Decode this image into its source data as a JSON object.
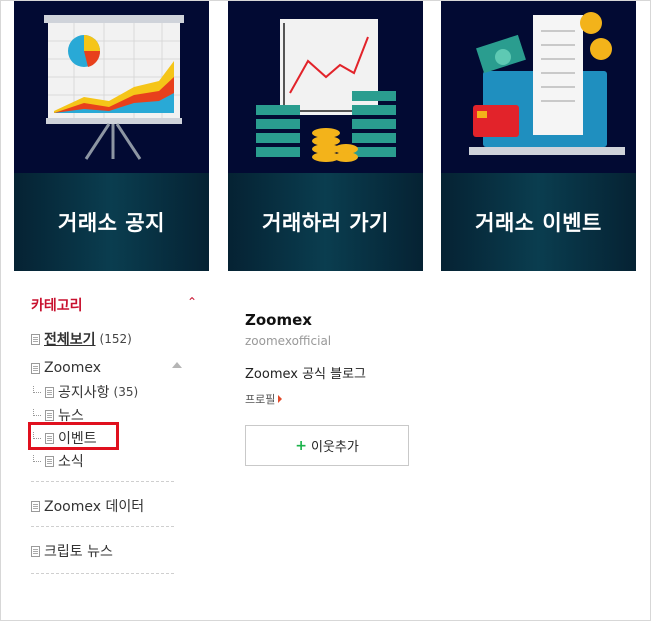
{
  "banners": [
    {
      "caption": "거래소 공지",
      "icon": "presentation-chart-icon"
    },
    {
      "caption": "거래하러 가기",
      "icon": "trading-chart-money-icon"
    },
    {
      "caption": "거래소 이벤트",
      "icon": "laptop-payment-icon"
    }
  ],
  "category": {
    "title": "카테고리",
    "toggle": "⌃",
    "all_label": "전체보기",
    "all_count": "(152)",
    "zoomex_label": "Zoomex",
    "sub_items": [
      {
        "label": "공지사항",
        "count": "(35)"
      },
      {
        "label": "뉴스"
      },
      {
        "label": "이벤트"
      },
      {
        "label": "소식"
      }
    ],
    "zoomex_data_label": "Zoomex 데이터",
    "crypto_news_label": "크립토 뉴스"
  },
  "profile": {
    "name": "Zoomex",
    "id": "zoomexofficial",
    "blog_title": "Zoomex 공식 블로그",
    "profile_link": "프로필",
    "add_neighbor": "이웃추가",
    "plus": "+"
  },
  "colors": {
    "accent": "#c8102e",
    "highlight": "#e0101e",
    "banner_bg": "#020a33",
    "plus": "#1bb34b"
  }
}
